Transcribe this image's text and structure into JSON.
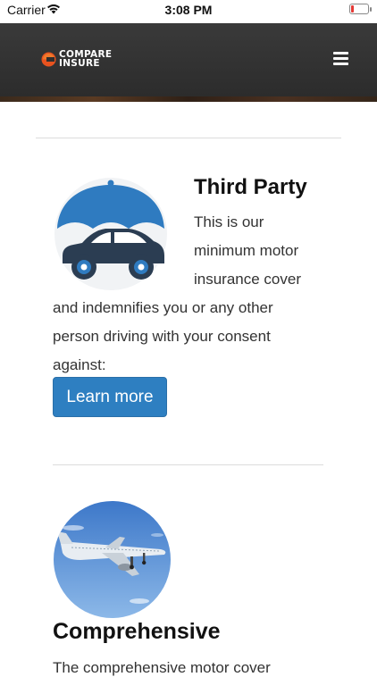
{
  "status_bar": {
    "carrier": "Carrier",
    "time": "3:08 PM"
  },
  "header": {
    "logo_line1": "COMPARE",
    "logo_line2": "INSURE",
    "menu_icon": "hamburger-menu-icon"
  },
  "third_party": {
    "title": "Third Party",
    "description_lines": [
      "This is our",
      "minimum motor",
      "insurance cover",
      "and indemnifies you or any other",
      "person driving with your consent",
      "against:"
    ],
    "button_label": "Learn more",
    "icon": "car-umbrella-icon"
  },
  "comprehensive": {
    "title": "Comprehensive",
    "description": "The comprehensive motor cover",
    "image": "airplane-photo"
  },
  "colors": {
    "button": "#2e7fc1",
    "header": "#2f2f2f",
    "umbrella": "#2f7bc0",
    "car": "#2b3d52"
  }
}
